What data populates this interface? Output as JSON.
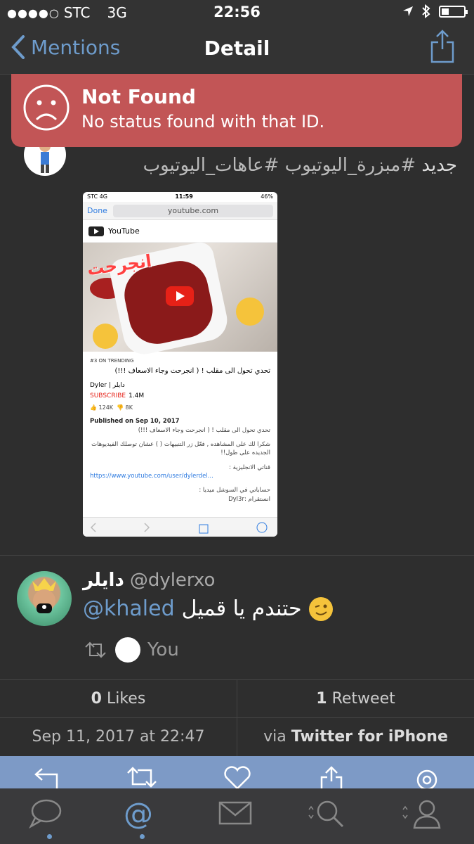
{
  "status_bar": {
    "carrier": "STC",
    "network": "3G",
    "time": "22:56"
  },
  "nav": {
    "back_label": "Mentions",
    "title": "Detail"
  },
  "alert": {
    "title": "Not Found",
    "message": "No status found with that ID."
  },
  "tweet1": {
    "text_plain": "جديد",
    "text_hashtags": "#مبزرة_اليوتيوب #عاهات_اليوتيوب",
    "screenshot": {
      "carrier": "STC",
      "network": "4G",
      "time": "11:59",
      "battery": "46%",
      "done_label": "Done",
      "url": "youtube.com",
      "app_name": "YouTube",
      "video_overlay": "انجرحت",
      "trending": "#3 ON TRENDING",
      "video_title": "تحدي تحول الى مقلب ! ( انجرحت وجاء الاسعاف !!!)",
      "channel": "Dyler | دايلر",
      "subscribe": "SUBSCRIBE",
      "subscribers": "1.4M",
      "likes": "124K",
      "dislikes": "8K",
      "published": "Published on Sep 10, 2017",
      "published_desc": "تحدي تحول الى مقلب ! ( انجرحت وجاء الاسعاف !!!)",
      "desc1": "شكرا لك على المشاهده , فعّل زر التنبيهات ( ) عشان توصلك الفيديوهات الجديده على طول!!",
      "desc2": "قناتي الانجليزية :",
      "link": "https://www.youtube.com/user/dylerdel...",
      "desc3": "حساباتي في السوشل ميديا :",
      "desc4": "انستقرام :Dyl3r"
    }
  },
  "tweet2": {
    "author_name": "دايلر",
    "author_handle": "@dylerxo",
    "mention": "@khaled",
    "text": "حتندم يا قميل",
    "retweeted_by": "You"
  },
  "stats": {
    "likes_count": "0",
    "likes_label": "Likes",
    "retweets_count": "1",
    "retweets_label": "Retweet"
  },
  "meta": {
    "date": "Sep 11, 2017 at 22:47",
    "via_prefix": "via",
    "client": "Twitter for iPhone"
  },
  "colors": {
    "accent": "#6e9ccc",
    "alert": "#c25556",
    "action_bar": "#7d9ac6",
    "background": "#2e2e2e"
  }
}
